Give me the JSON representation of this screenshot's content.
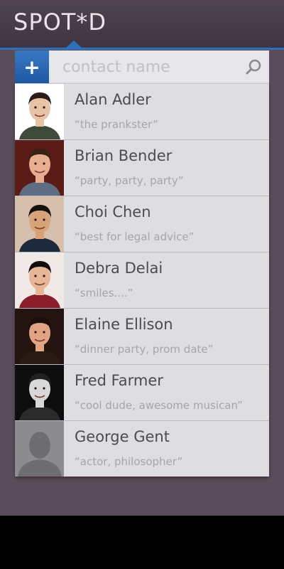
{
  "app": {
    "title": "SPOT*D"
  },
  "search": {
    "add_label": "+",
    "placeholder": "contact name",
    "icon": "search-icon"
  },
  "contacts": [
    {
      "name": "Alan Adler",
      "note": "“the prankster”",
      "skin": "#e9c3a5",
      "hair": "#2a1c14",
      "bg": "#ffffff",
      "shirt": "#3f4b3a"
    },
    {
      "name": "Brian Bender",
      "note": "“party, party, party”",
      "skin": "#e8ae92",
      "hair": "#3a2015",
      "bg": "#5b1b17",
      "shirt": "#5f6d84"
    },
    {
      "name": "Choi Chen",
      "note": "“best for legal advice”",
      "skin": "#d9a37a",
      "hair": "#141010",
      "bg": "#d6c0ad",
      "shirt": "#1e2a3c"
    },
    {
      "name": "Debra Delai",
      "note": "“smiles....”",
      "skin": "#e7b694",
      "hair": "#120c0a",
      "bg": "#f1e9e6",
      "shirt": "#8c1e2b"
    },
    {
      "name": "Elaine Ellison",
      "note": "“dinner party, prom date”",
      "skin": "#e1a383",
      "hair": "#1a0f0a",
      "bg": "#24140f",
      "shirt": "#2a1a14"
    },
    {
      "name": "Fred Farmer",
      "note": "“cool dude, awesome musican”",
      "skin": "#d8d8d8",
      "hair": "#202020",
      "bg": "#0d0d0d",
      "shirt": "#2b2b2b"
    },
    {
      "name": "George Gent",
      "note": "“actor, philosopher”",
      "skin": "#6e6e70",
      "hair": "#6e6e70",
      "bg": "#8c8c8f",
      "shirt": "#6e6e70"
    }
  ],
  "colors": {
    "accent": "#2f6fb9",
    "background": "#5a4c5b",
    "list_bg": "#dedde1"
  }
}
